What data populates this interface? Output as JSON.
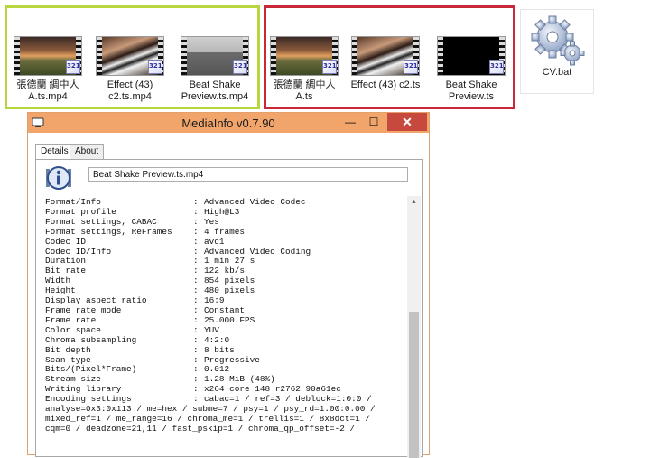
{
  "files": {
    "mp4": [
      {
        "name_line1": "張德蘭 綢中人",
        "name_line2": "A.ts.mp4",
        "thumb": "sunset"
      },
      {
        "name_line1": "Effect (43)",
        "name_line2": "c2.ts.mp4",
        "thumb": "piano"
      },
      {
        "name_line1": "Beat Shake",
        "name_line2": "Preview.ts.mp4",
        "thumb": "preview"
      }
    ],
    "ts": [
      {
        "name_line1": "張德蘭 綢中人",
        "name_line2": "A.ts",
        "thumb": "sunset"
      },
      {
        "name_line1": "Effect (43) c2.ts",
        "name_line2": "",
        "thumb": "piano"
      },
      {
        "name_line1": "Beat Shake",
        "name_line2": "Preview.ts",
        "thumb": "black"
      }
    ],
    "bat": {
      "name": "CV.bat",
      "icon": "gear-icon"
    },
    "badge_text": "321"
  },
  "window": {
    "title": "MediaInfo v0.7.90",
    "minimize": "—",
    "maximize": "☐",
    "close": "✕",
    "tabs": [
      "Details",
      "About"
    ],
    "file_name": "Beat Shake Preview.ts.mp4"
  },
  "report": [
    {
      "k": "Format/Info",
      "v": "Advanced Video Codec"
    },
    {
      "k": "Format profile",
      "v": "High@L3"
    },
    {
      "k": "Format settings, CABAC",
      "v": "Yes"
    },
    {
      "k": "Format settings, ReFrames",
      "v": "4 frames"
    },
    {
      "k": "Codec ID",
      "v": "avc1"
    },
    {
      "k": "Codec ID/Info",
      "v": "Advanced Video Coding"
    },
    {
      "k": "Duration",
      "v": "1 min 27 s"
    },
    {
      "k": "Bit rate",
      "v": "122 kb/s"
    },
    {
      "k": "Width",
      "v": "854 pixels"
    },
    {
      "k": "Height",
      "v": "480 pixels"
    },
    {
      "k": "Display aspect ratio",
      "v": "16:9"
    },
    {
      "k": "Frame rate mode",
      "v": "Constant"
    },
    {
      "k": "Frame rate",
      "v": "25.000 FPS"
    },
    {
      "k": "Color space",
      "v": "YUV"
    },
    {
      "k": "Chroma subsampling",
      "v": "4:2:0"
    },
    {
      "k": "Bit depth",
      "v": "8 bits"
    },
    {
      "k": "Scan type",
      "v": "Progressive"
    },
    {
      "k": "Bits/(Pixel*Frame)",
      "v": "0.012"
    },
    {
      "k": "Stream size",
      "v": "1.28 MiB (48%)"
    },
    {
      "k": "Writing library",
      "v": "x264 core 148 r2762 90a61ec"
    },
    {
      "k": "Encoding settings",
      "v": "cabac=1 / ref=3 / deblock=1:0:0 /"
    }
  ],
  "report_wrap": [
    "analyse=0x3:0x113 / me=hex / subme=7 / psy=1 / psy_rd=1.00:0.00 /",
    "mixed_ref=1 / me_range=16 / chroma_me=1 / trellis=1 / 8x8dct=1 /",
    "cqm=0 / deadzone=21,11 / fast_pskip=1 / chroma_qp_offset=-2 /"
  ],
  "colors": {
    "green_group": "#b6d83e",
    "red_group": "#c8283a",
    "titlebar": "#f1a56b",
    "close": "#c7493d"
  }
}
